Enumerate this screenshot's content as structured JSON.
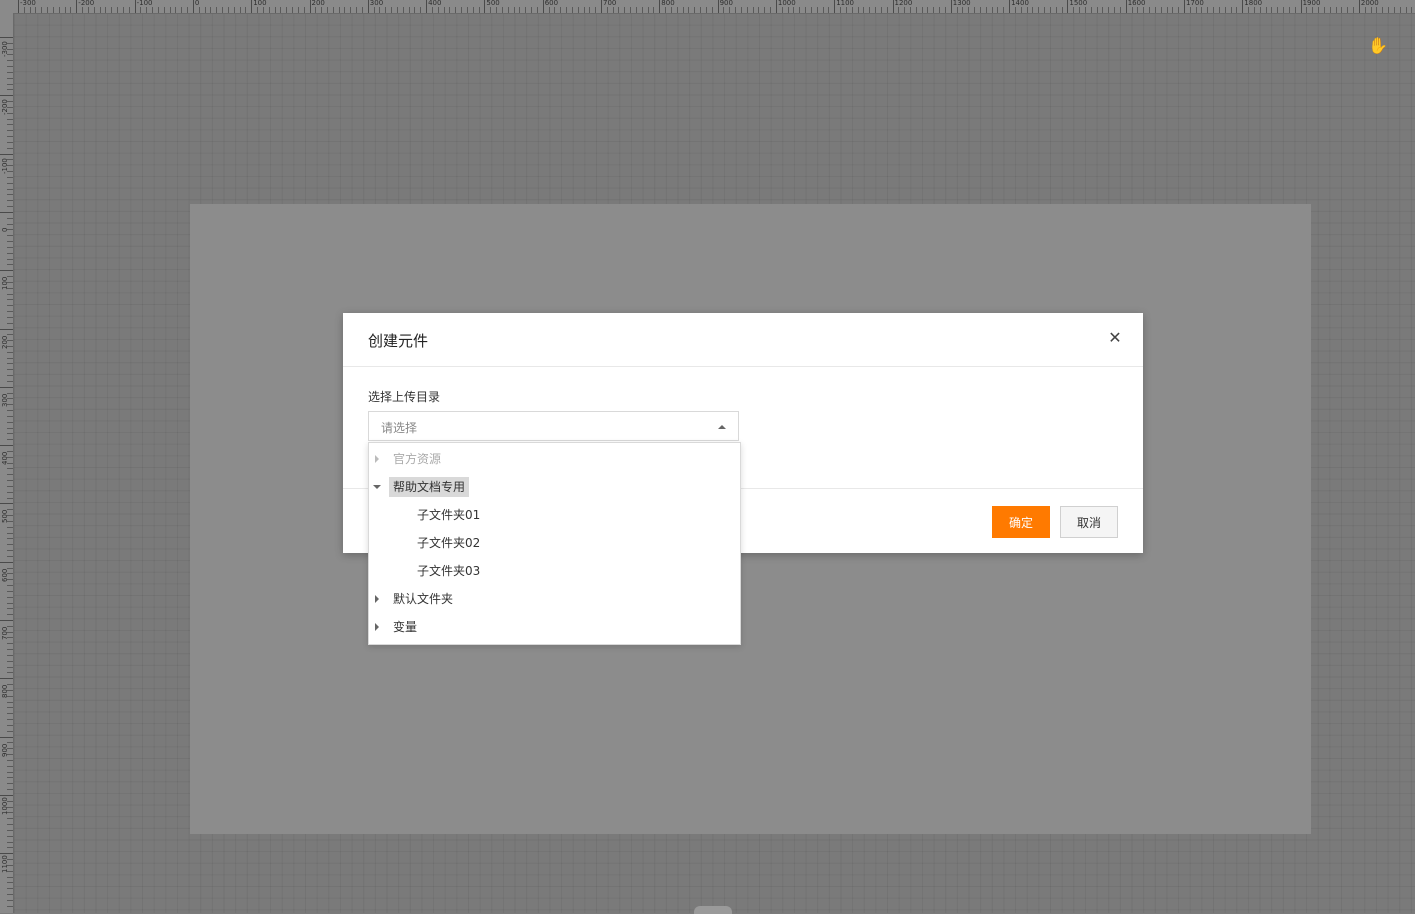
{
  "ruler": {
    "top_labels": [
      "-300",
      "-200",
      "-100",
      "0",
      "100",
      "200",
      "300",
      "400",
      "500",
      "600",
      "700",
      "800",
      "900",
      "1000",
      "1100",
      "1200",
      "1300",
      "1400",
      "1500",
      "1600",
      "1700",
      "1800",
      "1900",
      "2000"
    ],
    "left_labels": [
      "-300",
      "-200",
      "-100",
      "0",
      "100",
      "200",
      "300",
      "400",
      "500",
      "600",
      "700",
      "800",
      "900",
      "1000",
      "1100"
    ]
  },
  "modal": {
    "title": "创建元件",
    "field_label": "选择上传目录",
    "select_placeholder": "请选择",
    "ok_label": "确定",
    "cancel_label": "取消"
  },
  "tree": {
    "items": [
      {
        "label": "官方资源",
        "level": 0,
        "state": "collapsed",
        "disabled": true
      },
      {
        "label": "帮助文档专用",
        "level": 0,
        "state": "expanded",
        "selected": true
      },
      {
        "label": "子文件夹01",
        "level": 1
      },
      {
        "label": "子文件夹02",
        "level": 1
      },
      {
        "label": "子文件夹03",
        "level": 1
      },
      {
        "label": "默认文件夹",
        "level": 0,
        "state": "collapsed"
      },
      {
        "label": "变量",
        "level": 0,
        "state": "collapsed"
      }
    ]
  },
  "colors": {
    "accent": "#ff7a00",
    "overlay": "#7b7b7b",
    "artboard": "#8c8c8c"
  },
  "icons": {
    "close": "close-icon",
    "select_caret": "caret-up-icon",
    "cursor": "hand-cursor-icon"
  }
}
